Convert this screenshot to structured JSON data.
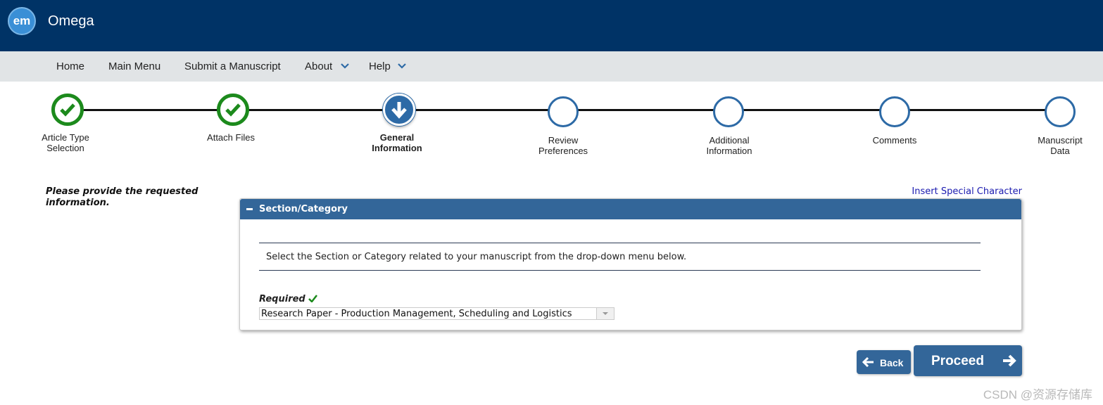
{
  "header": {
    "logo_text": "em",
    "app_name": "Omega"
  },
  "nav": {
    "items": [
      {
        "label": "Home"
      },
      {
        "label": "Main Menu"
      },
      {
        "label": "Submit a Manuscript"
      },
      {
        "label": "About",
        "has_dropdown": true
      },
      {
        "label": "Help",
        "has_dropdown": true
      }
    ]
  },
  "progress": {
    "steps": [
      {
        "label": "Article Type Selection",
        "line1": "Article Type",
        "line2": "Selection",
        "status": "done"
      },
      {
        "label": "Attach Files",
        "line1": "Attach Files",
        "line2": "",
        "status": "done"
      },
      {
        "label": "General Information",
        "line1": "General",
        "line2": "Information",
        "status": "current"
      },
      {
        "label": "Review Preferences",
        "line1": "Review",
        "line2": "Preferences",
        "status": "todo"
      },
      {
        "label": "Additional Information",
        "line1": "Additional",
        "line2": "Information",
        "status": "todo"
      },
      {
        "label": "Comments",
        "line1": "Comments",
        "line2": "",
        "status": "todo"
      },
      {
        "label": "Manuscript Data",
        "line1": "Manuscript",
        "line2": "Data",
        "status": "todo"
      }
    ]
  },
  "main": {
    "instructions": "Please provide the requested information.",
    "special_char_link": "Insert Special Character",
    "panel": {
      "title": "Section/Category",
      "help_text": "Select the Section or Category related to your manuscript from the drop-down menu below.",
      "required_label": "Required",
      "selected_value": "Research Paper - Production Management, Scheduling and Logistics"
    }
  },
  "buttons": {
    "back": "Back",
    "proceed": "Proceed"
  },
  "watermark": "CSDN @资源存储库",
  "colors": {
    "header_bg": "#003366",
    "nav_bg": "#e1e4e6",
    "accent": "#336699",
    "done_green": "#1c8a1c"
  }
}
